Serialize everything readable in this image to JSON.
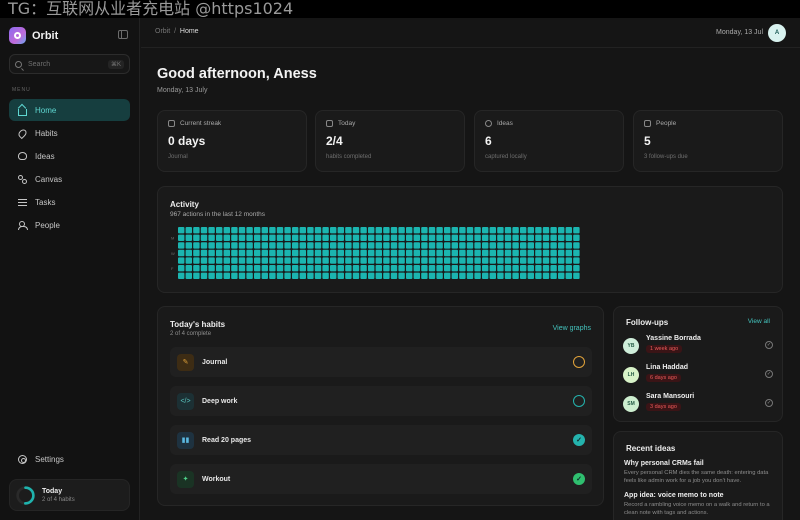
{
  "watermark": "TG：互联网从业者充电站 @https1024",
  "sidebar": {
    "brand": "Orbit",
    "search_placeholder": "Search",
    "search_shortcut": "⌘K",
    "menu_label": "MENU",
    "items": [
      {
        "label": "Home",
        "icon": "home-icon"
      },
      {
        "label": "Habits",
        "icon": "flame-icon"
      },
      {
        "label": "Ideas",
        "icon": "bulb-icon"
      },
      {
        "label": "Canvas",
        "icon": "nodes-icon"
      },
      {
        "label": "Tasks",
        "icon": "list-icon"
      },
      {
        "label": "People",
        "icon": "people-icon"
      }
    ],
    "settings": "Settings",
    "today": {
      "title": "Today",
      "sub": "2 of 4 habits",
      "progress": 0.5
    }
  },
  "topbar": {
    "crumb_root": "Orbit",
    "crumb_sep": "/",
    "crumb_current": "Home",
    "date": "Monday, 13 Jul",
    "avatar": "A"
  },
  "greeting": {
    "title": "Good afternoon, Aness",
    "date": "Monday, 13 July"
  },
  "stats": [
    {
      "label": "Current streak",
      "value": "0 days",
      "sub": "Journal"
    },
    {
      "label": "Today",
      "value": "2/4",
      "sub": "habits completed"
    },
    {
      "label": "Ideas",
      "value": "6",
      "sub": "captured locally"
    },
    {
      "label": "People",
      "value": "5",
      "sub": "3 follow-ups due"
    }
  ],
  "activity": {
    "title": "Activity",
    "sub": "967 actions in the last 12 months",
    "day_labels": [
      "M",
      "W",
      "F"
    ],
    "color": "#1bb5b0"
  },
  "habits": {
    "title": "Today's habits",
    "sub": "2 of 4 complete",
    "link": "View graphs",
    "items": [
      {
        "name": "Journal",
        "done": false,
        "ring": "#e0a23a",
        "icon_bg": "#3d2c14",
        "icon_fg": "#e0a23a",
        "glyph": "✎"
      },
      {
        "name": "Deep work",
        "done": false,
        "ring": "#24b3ad",
        "icon_bg": "#1c3034",
        "icon_fg": "#5cc8c2",
        "glyph": "</>"
      },
      {
        "name": "Read 20 pages",
        "done": true,
        "ring": "#24b3ad",
        "icon_bg": "#1e3240",
        "icon_fg": "#5ab8e0",
        "glyph": "▮▮"
      },
      {
        "name": "Workout",
        "done": true,
        "ring": "#2fbf6f",
        "icon_bg": "#1a3324",
        "icon_fg": "#4fd38a",
        "glyph": "✦"
      }
    ]
  },
  "followups": {
    "title": "Follow-ups",
    "link": "View all",
    "items": [
      {
        "initials": "YB",
        "name": "Yassine Borrada",
        "badge": "1 week ago"
      },
      {
        "initials": "LH",
        "name": "Lina Haddad",
        "badge": "6 days ago"
      },
      {
        "initials": "SM",
        "name": "Sara Mansouri",
        "badge": "3 days ago"
      }
    ]
  },
  "ideas": {
    "title": "Recent ideas",
    "items": [
      {
        "title": "Why personal CRMs fail",
        "body": "Every personal CRM dies the same death: entering data feels like admin work for a job you don't have."
      },
      {
        "title": "App idea: voice memo to note",
        "body": "Record a rambling voice memo on a walk and return to a clean note with tags and actions."
      }
    ]
  }
}
